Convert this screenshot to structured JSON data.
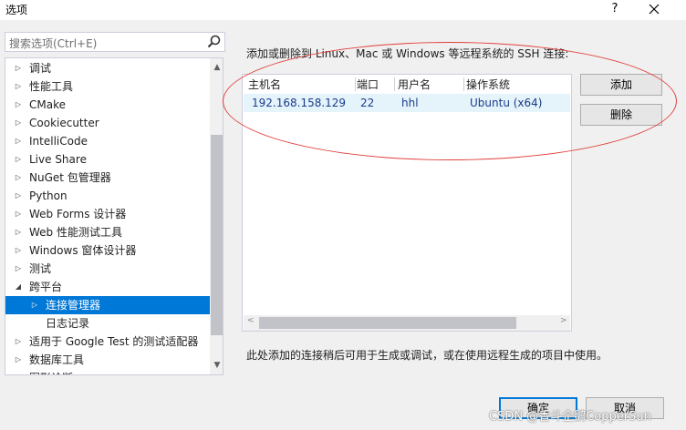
{
  "window": {
    "title": "选项",
    "help_label": "?",
    "close_label": "✕"
  },
  "search": {
    "placeholder": "搜索选项(Ctrl+E)"
  },
  "tree": {
    "items": [
      {
        "label": "调试",
        "arrow": "▷"
      },
      {
        "label": "性能工具",
        "arrow": "▷"
      },
      {
        "label": "CMake",
        "arrow": "▷"
      },
      {
        "label": "Cookiecutter",
        "arrow": "▷"
      },
      {
        "label": "IntelliCode",
        "arrow": "▷"
      },
      {
        "label": "Live Share",
        "arrow": "▷"
      },
      {
        "label": "NuGet 包管理器",
        "arrow": "▷"
      },
      {
        "label": "Python",
        "arrow": "▷"
      },
      {
        "label": "Web Forms 设计器",
        "arrow": "▷"
      },
      {
        "label": "Web 性能测试工具",
        "arrow": "▷"
      },
      {
        "label": "Windows 窗体设计器",
        "arrow": "▷"
      },
      {
        "label": "测试",
        "arrow": "▷"
      },
      {
        "label": "跨平台",
        "arrow": "◢"
      },
      {
        "label": "连接管理器",
        "arrow": "▷"
      },
      {
        "label": "日志记录",
        "arrow": ""
      },
      {
        "label": "适用于 Google Test 的测试适配器",
        "arrow": "▷"
      },
      {
        "label": "数据库工具",
        "arrow": "▷"
      },
      {
        "label": "图形诊断",
        "arrow": "▷"
      }
    ],
    "selected_index": 13,
    "scroll_up": "▲",
    "scroll_down": "▼"
  },
  "main": {
    "description": "添加或删除到 Linux、Mac 或 Windows 等远程系统的 SSH 连接:",
    "columns": [
      "主机名",
      "端口",
      "用户名",
      "操作系统"
    ],
    "rows": [
      {
        "host": "192.168.158.129",
        "port": "22",
        "user": "hhl",
        "os": "Ubuntu (x64)"
      }
    ],
    "add_label": "添加",
    "remove_label": "删除",
    "note": "此处添加的连接稍后可用于生成或调试，或在使用远程生成的项目中使用。"
  },
  "footer": {
    "ok_label": "确定",
    "cancel_label": "取消"
  },
  "watermark": "CSDN @香斗企鹅CopperSun",
  "colors": {
    "selection": "#0078d7",
    "annotation": "#e0413c"
  }
}
